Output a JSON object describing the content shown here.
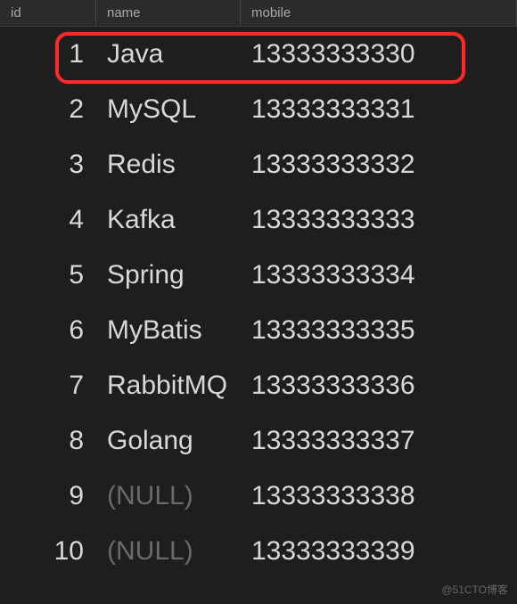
{
  "columns": {
    "id": "id",
    "name": "name",
    "mobile": "mobile"
  },
  "rows": [
    {
      "id": "1",
      "name": "Java",
      "mobile": "13333333330",
      "name_null": false,
      "highlighted": true
    },
    {
      "id": "2",
      "name": "MySQL",
      "mobile": "13333333331",
      "name_null": false,
      "highlighted": false
    },
    {
      "id": "3",
      "name": "Redis",
      "mobile": "13333333332",
      "name_null": false,
      "highlighted": false
    },
    {
      "id": "4",
      "name": "Kafka",
      "mobile": "13333333333",
      "name_null": false,
      "highlighted": false
    },
    {
      "id": "5",
      "name": "Spring",
      "mobile": "13333333334",
      "name_null": false,
      "highlighted": false
    },
    {
      "id": "6",
      "name": "MyBatis",
      "mobile": "13333333335",
      "name_null": false,
      "highlighted": false
    },
    {
      "id": "7",
      "name": "RabbitMQ",
      "mobile": "13333333336",
      "name_null": false,
      "highlighted": false
    },
    {
      "id": "8",
      "name": "Golang",
      "mobile": "13333333337",
      "name_null": false,
      "highlighted": false
    },
    {
      "id": "9",
      "name": "(NULL)",
      "mobile": "13333333338",
      "name_null": true,
      "highlighted": false
    },
    {
      "id": "10",
      "name": "(NULL)",
      "mobile": "13333333339",
      "name_null": true,
      "highlighted": false
    }
  ],
  "watermark": "@51CTO博客",
  "chart_data": {
    "type": "table",
    "title": "",
    "columns": [
      "id",
      "name",
      "mobile"
    ],
    "rows": [
      [
        1,
        "Java",
        "13333333330"
      ],
      [
        2,
        "MySQL",
        "13333333331"
      ],
      [
        3,
        "Redis",
        "13333333332"
      ],
      [
        4,
        "Kafka",
        "13333333333"
      ],
      [
        5,
        "Spring",
        "13333333334"
      ],
      [
        6,
        "MyBatis",
        "13333333335"
      ],
      [
        7,
        "RabbitMQ",
        "13333333336"
      ],
      [
        8,
        "Golang",
        "13333333337"
      ],
      [
        9,
        null,
        "13333333338"
      ],
      [
        10,
        null,
        "13333333339"
      ]
    ]
  }
}
